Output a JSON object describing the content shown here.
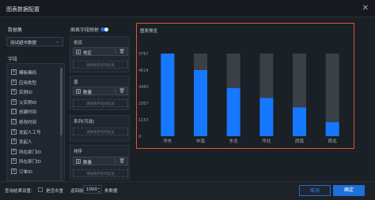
{
  "dialog": {
    "title": "图表数据配置",
    "close_glyph": "✕"
  },
  "left": {
    "dataset_label": "数据集",
    "dataset_value": "测试超市数据",
    "fields_label": "字段",
    "fields": [
      {
        "type": "A",
        "name": "模板编码"
      },
      {
        "type": "A",
        "name": "应用类型"
      },
      {
        "type": "A",
        "name": "实例ID"
      },
      {
        "type": "A",
        "name": "父实例ID"
      },
      {
        "type": "□",
        "name": "创建时间"
      },
      {
        "type": "□",
        "name": "修改时间"
      },
      {
        "type": "A",
        "name": "发起人工号"
      },
      {
        "type": "A",
        "name": "发起人"
      },
      {
        "type": "A",
        "name": "所在部门ID"
      },
      {
        "type": "A",
        "name": "所在部门ID"
      },
      {
        "type": "A",
        "name": "订单ID"
      }
    ]
  },
  "middle": {
    "header": "图表字段映射",
    "category_label": "类目",
    "category_field": "地区",
    "category_placeholder": "请拖拽字段到此处",
    "value_label": "值",
    "value_field": "数量",
    "value_placeholder": "请拖拽字段到此处",
    "series_label": "系列(可选)",
    "series_placeholder": "请拖拽字段到此处",
    "sort_label": "排序",
    "sort_field": "数量",
    "sort_placeholder": "请拖拽字段到此处"
  },
  "preview": {
    "title": "图表预览"
  },
  "chart_data": {
    "type": "bar",
    "categories": [
      "华东",
      "中南",
      "东北",
      "华北",
      "西南",
      "西北"
    ],
    "values": [
      5767,
      4614,
      3356,
      2667,
      2006,
      975
    ],
    "background_values": [
      5767,
      5767,
      5767,
      5767,
      5767,
      5767
    ],
    "yticks": [
      "5767",
      "4614",
      "3460",
      "2307",
      "1153",
      "0"
    ],
    "ylim": [
      0,
      5767
    ],
    "colors": {
      "bar": "#1677ff",
      "track": "#3b3f46"
    }
  },
  "footer": {
    "query_label": "查询结果设置:",
    "dedupe_label": "是否去重",
    "return_prefix": "返回前",
    "return_count": "1000",
    "return_suffix": "条数据",
    "cancel_label": "取消",
    "confirm_label": "确定"
  },
  "colors": {
    "accent": "#1e6fd9",
    "highlight_border": "#e0562f"
  }
}
